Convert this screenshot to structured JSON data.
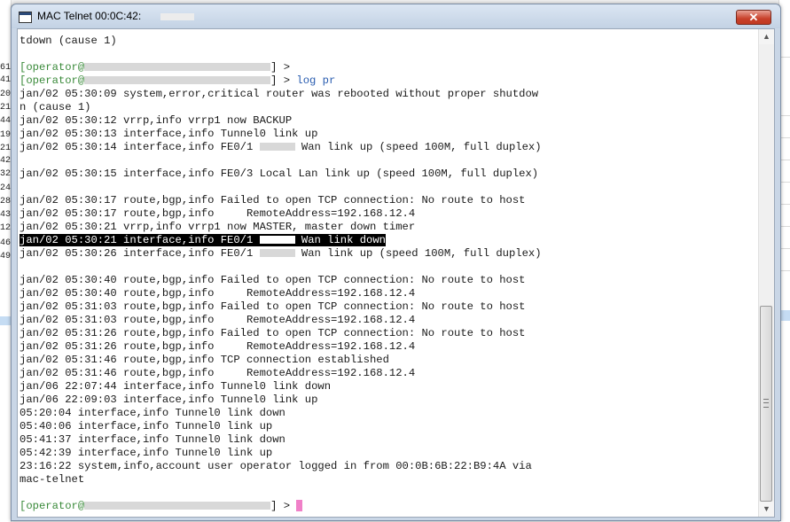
{
  "window": {
    "title": "MAC Telnet 00:0C:42:",
    "close_glyph": "✕",
    "app_icon": "terminal-window-icon"
  },
  "background": {
    "left_numbers": [
      "61",
      "41",
      "20",
      "21",
      "44",
      "19",
      "21",
      "42",
      "32",
      "24",
      "28",
      "43",
      "12",
      "46",
      "49"
    ]
  },
  "terminal": {
    "lines": [
      {
        "text": "tdown (cause 1)"
      },
      {
        "text": ""
      },
      {
        "prompt": "[operator@",
        "redacted": true,
        "suffix": "] >"
      },
      {
        "prompt": "[operator@",
        "redacted": true,
        "suffix": "] > ",
        "command": "log pr"
      },
      {
        "text": "jan/02 05:30:09 system,error,critical router was rebooted without proper shutdow"
      },
      {
        "text": "n (cause 1)"
      },
      {
        "text": "jan/02 05:30:12 vrrp,info vrrp1 now BACKUP"
      },
      {
        "text": "jan/02 05:30:13 interface,info Tunnel0 link up"
      },
      {
        "text_a": "jan/02 05:30:14 interface,info FE0/1 ",
        "text_b": " Wan link up (speed 100M, full duplex)"
      },
      {
        "text": ""
      },
      {
        "text": "jan/02 05:30:15 interface,info FE0/3 Local Lan link up (speed 100M, full duplex)"
      },
      {
        "text": ""
      },
      {
        "text": "jan/02 05:30:17 route,bgp,info Failed to open TCP connection: No route to host"
      },
      {
        "text": "jan/02 05:30:17 route,bgp,info     RemoteAddress=192.168.12.4"
      },
      {
        "text": "jan/02 05:30:21 vrrp,info vrrp1 now MASTER, master down timer"
      },
      {
        "text_a": "jan/02 05:30:21 interface,info FE0/1 ",
        "text_b": " Wan link down",
        "highlighted": true
      },
      {
        "text_a": "jan/02 05:30:26 interface,info FE0/1 ",
        "text_b": " Wan link up (speed 100M, full duplex)"
      },
      {
        "text": ""
      },
      {
        "text": "jan/02 05:30:40 route,bgp,info Failed to open TCP connection: No route to host"
      },
      {
        "text": "jan/02 05:30:40 route,bgp,info     RemoteAddress=192.168.12.4"
      },
      {
        "text": "jan/02 05:31:03 route,bgp,info Failed to open TCP connection: No route to host"
      },
      {
        "text": "jan/02 05:31:03 route,bgp,info     RemoteAddress=192.168.12.4"
      },
      {
        "text": "jan/02 05:31:26 route,bgp,info Failed to open TCP connection: No route to host"
      },
      {
        "text": "jan/02 05:31:26 route,bgp,info     RemoteAddress=192.168.12.4"
      },
      {
        "text": "jan/02 05:31:46 route,bgp,info TCP connection established"
      },
      {
        "text": "jan/02 05:31:46 route,bgp,info     RemoteAddress=192.168.12.4"
      },
      {
        "text": "jan/06 22:07:44 interface,info Tunnel0 link down"
      },
      {
        "text": "jan/06 22:09:03 interface,info Tunnel0 link up"
      },
      {
        "text": "05:20:04 interface,info Tunnel0 link down"
      },
      {
        "text": "05:40:06 interface,info Tunnel0 link up"
      },
      {
        "text": "05:41:37 interface,info Tunnel0 link down"
      },
      {
        "text": "05:42:39 interface,info Tunnel0 link up"
      },
      {
        "text": "23:16:22 system,info,account user operator logged in from 00:0B:6B:22:B9:4A via"
      },
      {
        "text": "mac-telnet"
      },
      {
        "text": ""
      },
      {
        "prompt": "[operator@",
        "redacted": true,
        "suffix": "] > ",
        "cursor": true
      }
    ]
  },
  "colors": {
    "prompt": "#3a8a3a",
    "command": "#2a5db0",
    "cursor": "#f080c8",
    "highlight_bg": "#000000"
  },
  "scrollbar": {
    "up_icon": "▲",
    "down_icon": "▼"
  }
}
